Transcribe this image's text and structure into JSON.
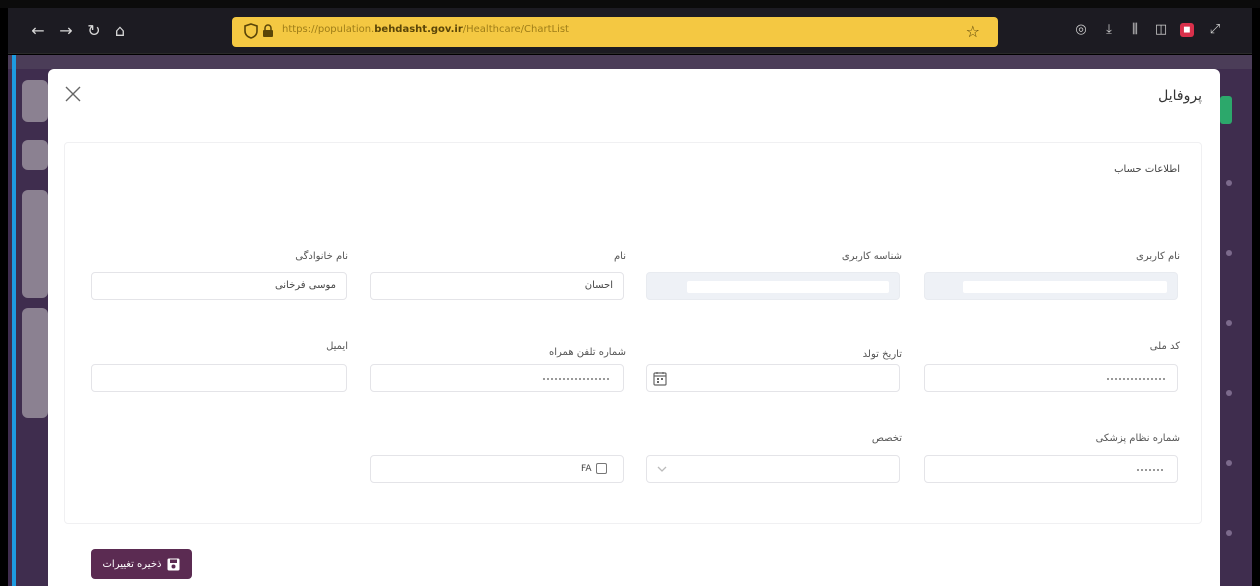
{
  "browser": {
    "url_prefix": "https://population.",
    "url_domain": "behdasht.gov.ir",
    "url_path": "/Healthcare/ChartList"
  },
  "modal": {
    "title": "پروفایل",
    "section_title": "اطلاعات حساب",
    "fields": {
      "username": {
        "label": "نام کاربری"
      },
      "user_id": {
        "label": "شناسه کاربری"
      },
      "first_name": {
        "label": "نام",
        "value": "احسان"
      },
      "last_name": {
        "label": "نام خانوادگی",
        "value": "موسی فرخانی"
      },
      "national_code": {
        "label": "کد ملی"
      },
      "birth_date": {
        "label": "تاریخ تولد"
      },
      "mobile": {
        "label": "شماره تلفن همراه"
      },
      "email": {
        "label": "ایمیل"
      },
      "medical_council": {
        "label": "شماره نظام پزشکی"
      },
      "specialty": {
        "label": "تخصص"
      },
      "fa_checkbox": {
        "label": "FA"
      }
    },
    "save_label": "ذخیره تغییرات"
  },
  "colors": {
    "accent": "#5b2b52",
    "urlbar": "#f4c842",
    "app_bg": "#3f2d4e"
  }
}
